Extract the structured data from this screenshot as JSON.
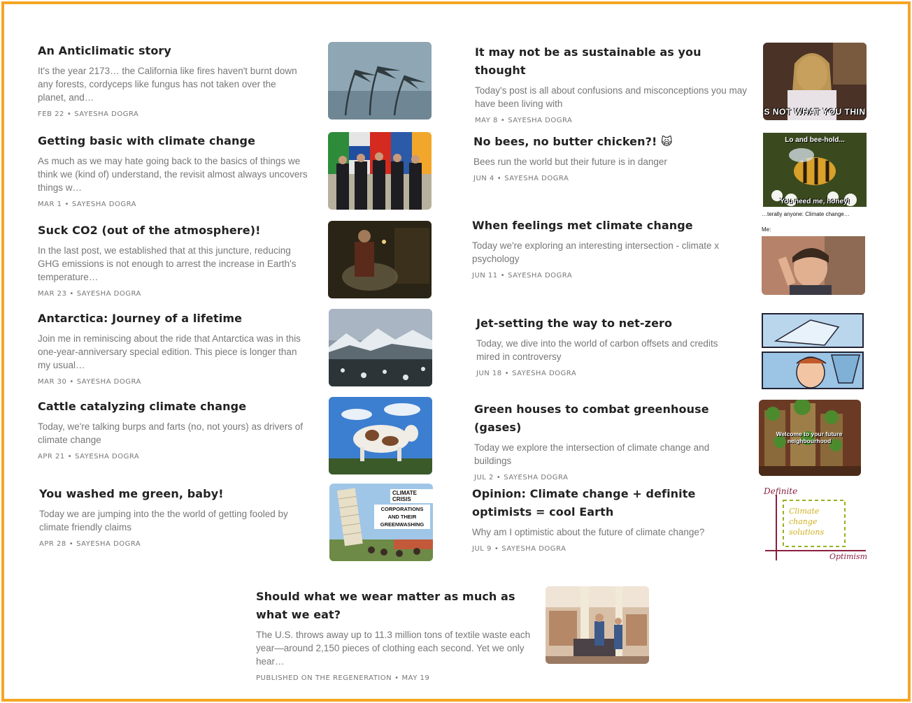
{
  "posts": [
    {
      "title": "An Anticlimatic story",
      "desc": "It's the year 2173… the California like fires haven't burnt down any forests, cordyceps like fungus has not taken over the planet, and…",
      "date": "FEB 22",
      "author": "SAYESHA DOGRA",
      "image": "storm-palm-trees"
    },
    {
      "title": "Getting basic with climate change",
      "desc": "As much as we may hate going back to the basics of things we think we (kind of) understand, the revisit almost always uncovers things w…",
      "date": "MAR 1",
      "author": "SAYESHA DOGRA",
      "image": "world-leaders-flags"
    },
    {
      "title": "Suck CO2 (out of the atmosphere)!",
      "desc": "In the last post, we established that at this juncture, reducing GHG emissions is not enough to arrest the increase in Earth's temperature…",
      "date": "MAR 23",
      "author": "SAYESHA DOGRA",
      "image": "dark-movie-scene"
    },
    {
      "title": "Antarctica: Journey of a lifetime",
      "desc": "Join me in reminiscing about the ride that Antarctica was in this one-year-anniversary special edition. This piece is longer than my usual…",
      "date": "MAR 30",
      "author": "SAYESHA DOGRA",
      "image": "antarctica-coast"
    },
    {
      "title": "Cattle catalyzing climate change",
      "desc": "Today, we're talking burps and farts (no, not yours) as drivers of climate change",
      "date": "APR 21",
      "author": "SAYESHA DOGRA",
      "image": "giant-cow"
    },
    {
      "title": "You washed me green, baby!",
      "desc": "Today we are jumping into the the world of getting fooled by climate friendly claims",
      "date": "APR 28",
      "author": "SAYESHA DOGRA",
      "image": "leaning-tower-meme"
    },
    {
      "title": "It may not be as sustainable as you thought",
      "desc": "Today's post is all about confusions and misconceptions you may have been living with",
      "date": "MAY 8",
      "author": "SAYESHA DOGRA",
      "image": "woman-meme"
    },
    {
      "title": "No bees, no butter chicken?! 🙀",
      "desc": "Bees run the world but their future is in danger",
      "date": "JUN 4",
      "author": "SAYESHA DOGRA",
      "image": "bee-meme"
    },
    {
      "title": "When feelings met climate change",
      "desc": "Today we're exploring an interesting intersection - climate x psychology",
      "date": "JUN 11",
      "author": "SAYESHA DOGRA",
      "image": "office-meme"
    },
    {
      "title": "Jet-setting the way to net-zero",
      "desc": "Today, we dive into the world of carbon offsets and credits mired in controversy",
      "date": "JUN 18",
      "author": "SAYESHA DOGRA",
      "image": "comic-panels"
    },
    {
      "title": "Green houses to combat greenhouse (gases)",
      "desc": "Today we explore the intersection of climate change and buildings",
      "date": "JUL 2",
      "author": "SAYESHA DOGRA",
      "image": "green-buildings"
    },
    {
      "title": "Opinion: Climate change + definite optimists = cool Earth",
      "desc": "Why am I optimistic about the future of climate change?",
      "date": "JUL 9",
      "author": "SAYESHA DOGRA",
      "image": "optimism-chart"
    },
    {
      "title": "Should what we wear matter as much as what we eat?",
      "desc": "The U.S. throws away up to 11.3 million tons of textile waste each year—around 2,150 pieces of clothing each second. Yet we only hear…",
      "date": "MAY 19",
      "author": "PUBLISHED ON THE REGENERATION",
      "image": "clothing-store"
    }
  ],
  "captions": {
    "woman_meme": "S NOT WHAT YOU THIN",
    "bee_top": "Lo and bee-hold...",
    "bee_bottom": "You need me, honey!",
    "office_top": "…terally anyone: Climate change…",
    "office_me": "Me:",
    "tower_1": "CLIMATE CRISIS",
    "tower_2": "CORPORATIONS AND THEIR GREENWASHING",
    "buildings": "Welcome to your future neighbourhood",
    "opt_y": "Definite",
    "opt_box": "Climate change solutions",
    "opt_x": "Optimism"
  },
  "colors": {
    "border": "#f5a623",
    "title": "#222222",
    "muted": "#777777"
  }
}
